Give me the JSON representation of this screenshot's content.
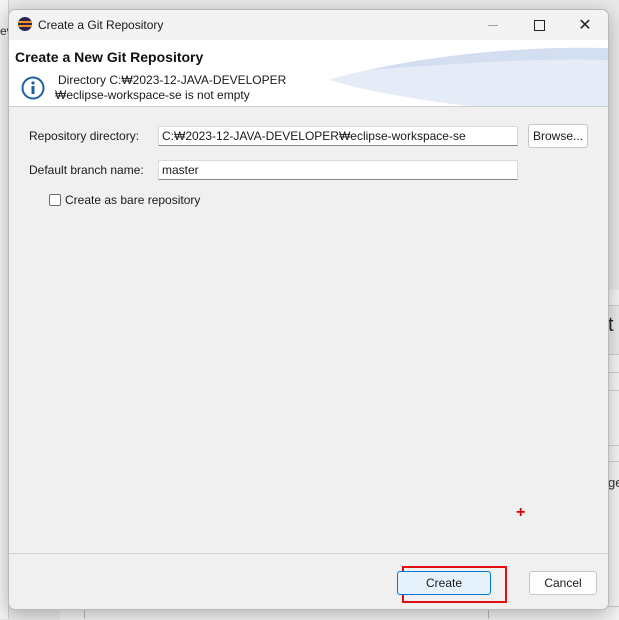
{
  "background": {
    "left_edge_text": "ev",
    "right_glyph_1": "t",
    "right_glyph_2": "ge"
  },
  "dialog": {
    "title": "Create a Git Repository",
    "header_title": "Create a New Git Repository",
    "message_line1": "Directory C:₩2023-12-JAVA-DEVELOPER",
    "message_line2": "₩eclipse-workspace-se is not empty",
    "message_icon": "info-icon"
  },
  "form": {
    "repo_dir_label": "Repository directory:",
    "repo_dir_value": "C:₩2023-12-JAVA-DEVELOPER₩eclipse-workspace-se",
    "browse_label": "Browse...",
    "branch_label": "Default branch name:",
    "branch_value": "master",
    "bare_label": "Create as bare repository",
    "bare_checked": false
  },
  "footer": {
    "create_label": "Create",
    "cancel_label": "Cancel"
  },
  "annotations": {
    "cursor_marker": "+"
  },
  "colors": {
    "accent": "#0078d4",
    "highlight": "#e01010",
    "eclipse_purple": "#2c2255",
    "eclipse_orange": "#f7941e",
    "info_blue": "#1f5fa8"
  }
}
